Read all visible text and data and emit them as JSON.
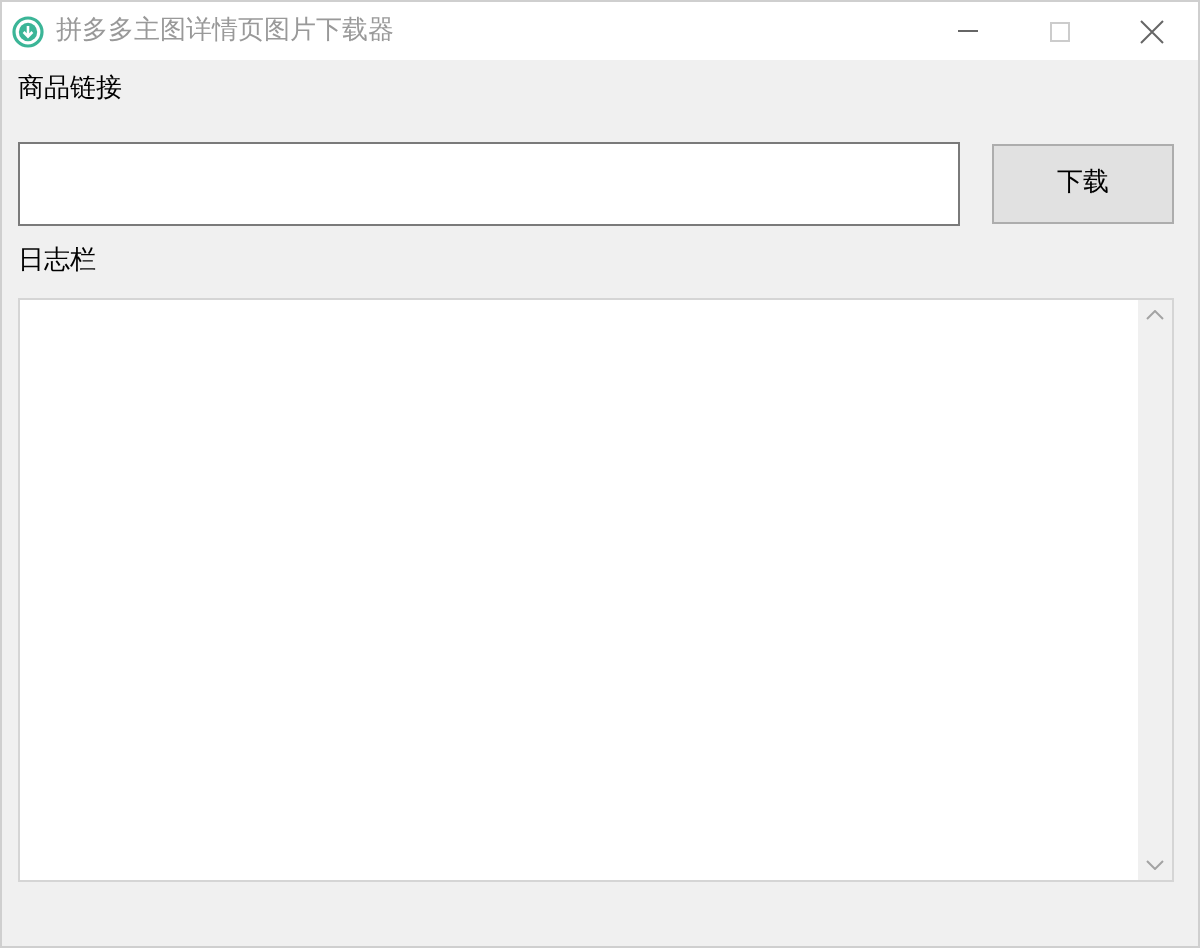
{
  "window": {
    "title": "拼多多主图详情页图片下载器",
    "maximize_disabled": true
  },
  "link_label": "商品链接",
  "download_button": "下载",
  "log_label": "日志栏"
}
